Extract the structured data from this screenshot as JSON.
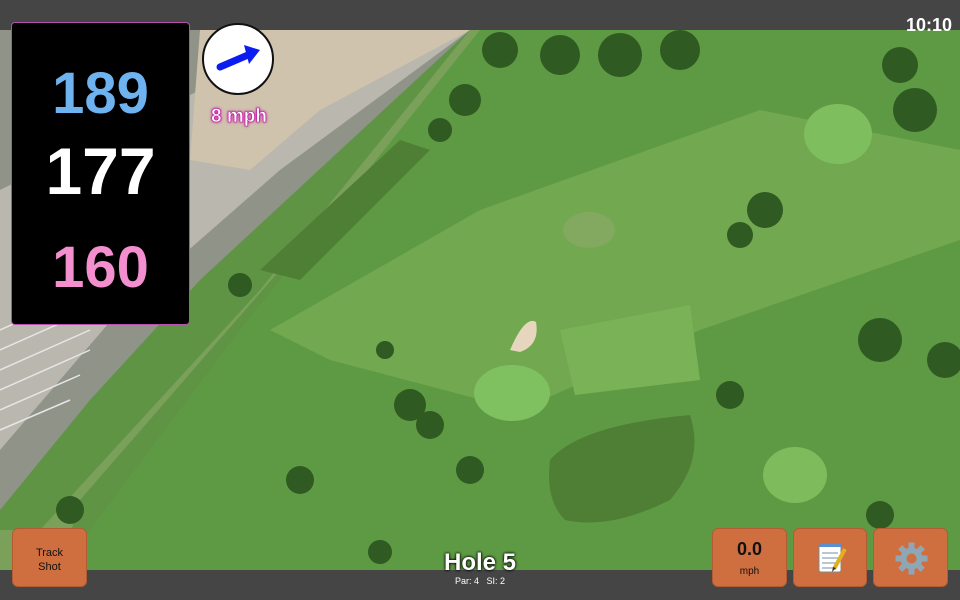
{
  "status_bar": {
    "time": "10:10"
  },
  "yardage": {
    "back": "189",
    "middle": "177",
    "front": "160"
  },
  "wind": {
    "speed_text": "8 mph",
    "direction": "east-northeast"
  },
  "buttons": {
    "track_shot_line1": "Track",
    "track_shot_line2": "Shot",
    "speed_value": "0.0",
    "speed_unit": "mph",
    "notes_icon": "notepad-icon",
    "settings_icon": "gear-icon"
  },
  "hole": {
    "title": "Hole 5",
    "par_text": "Par: 4",
    "si_text": "SI: 2"
  },
  "colors": {
    "accent_button": "#cf6e3f",
    "back_yardage": "#6eb2ef",
    "middle_yardage": "#ffffff",
    "front_yardage": "#f48fcf",
    "wind_label_outline": "#c21aa3"
  }
}
